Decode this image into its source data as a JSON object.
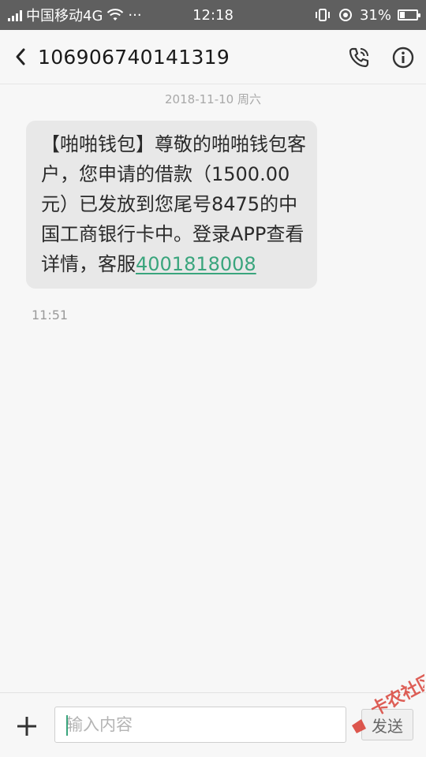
{
  "status_bar": {
    "carrier": "中国移动4G",
    "overflow": "···",
    "time": "12:18",
    "battery_percent_label": "31%",
    "battery_level": 0.31
  },
  "header": {
    "title": "106906740141319",
    "back_icon": "chevron-left-icon",
    "call_icon": "phone-icon",
    "info_icon": "info-icon"
  },
  "conversation": {
    "date_divider": "2018-11-10 周六",
    "message": {
      "text": "【啪啪钱包】尊敬的啪啪钱包客户，您申请的借款（1500.00元）已发放到您尾号8475的中国工商银行卡中。登录APP查看详情，客服",
      "phone_link": "4001818008",
      "time": "11:51"
    }
  },
  "compose": {
    "attach_icon": "plus-icon",
    "input_placeholder": "输入内容",
    "send_label": "发送"
  },
  "colors": {
    "status_bar_bg": "#5f5f5f",
    "bubble_bg": "#e8e8e8",
    "link": "#3aa57d"
  }
}
